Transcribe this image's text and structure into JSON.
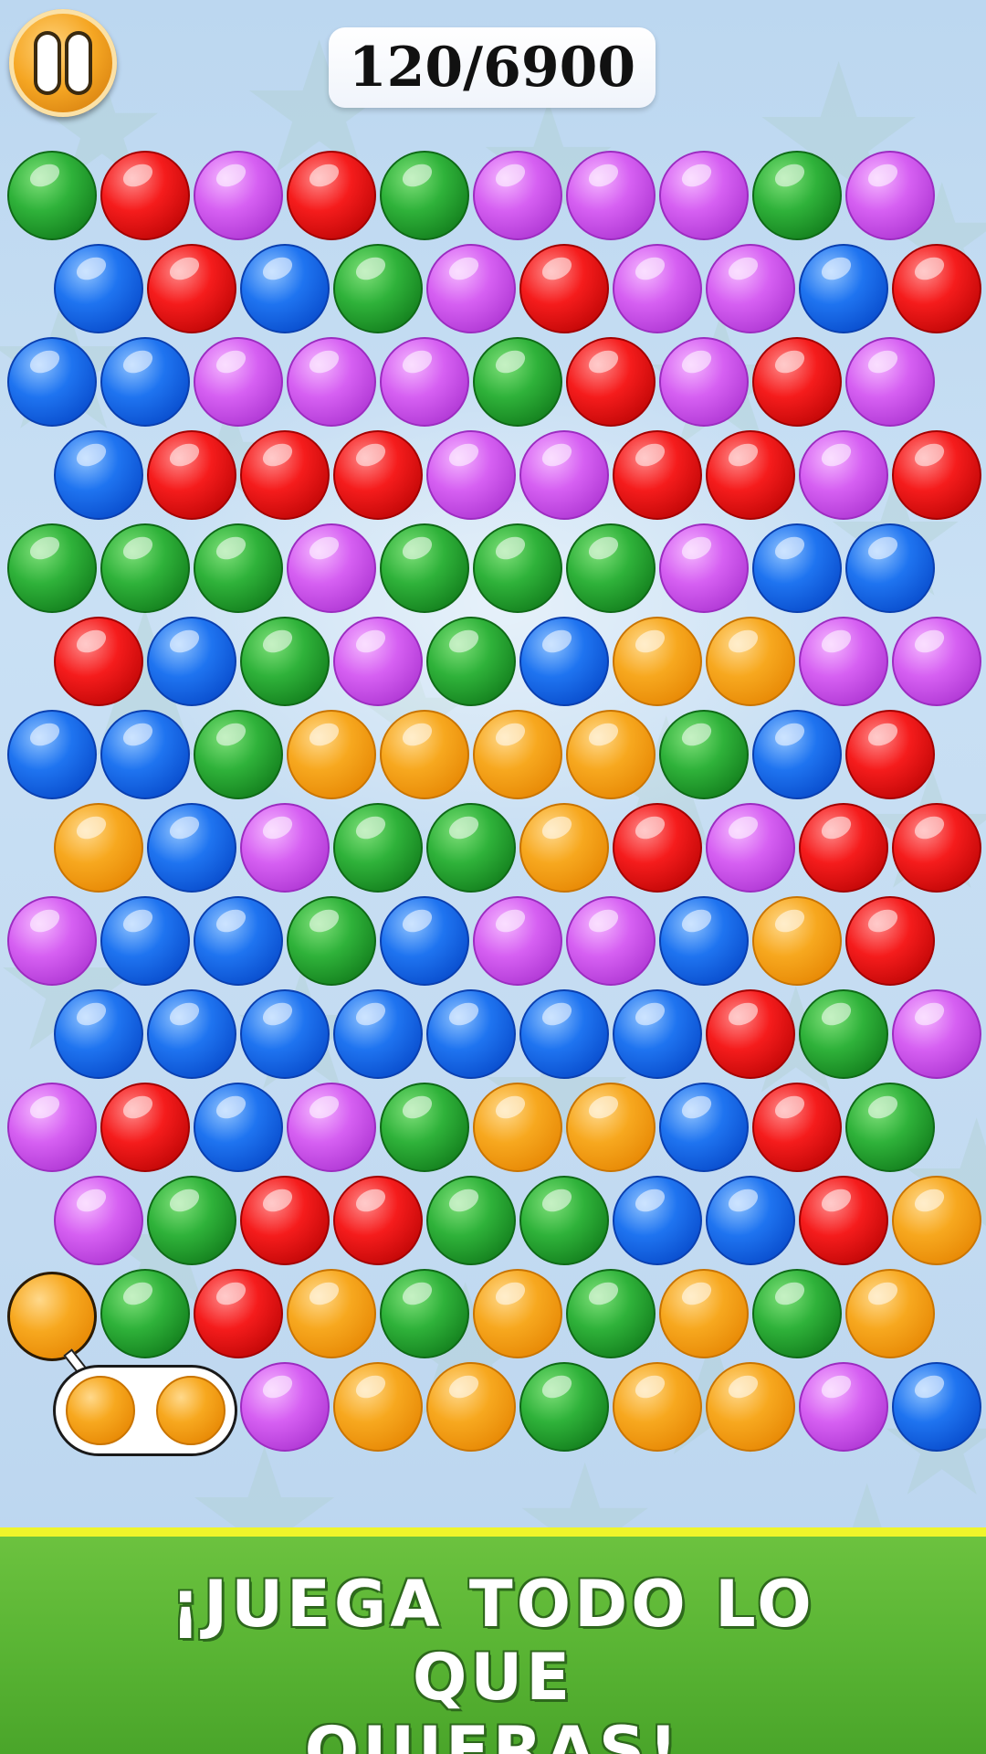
{
  "hud": {
    "score_text": "120/6900",
    "pause_icon": "pause-icon"
  },
  "banner": {
    "line1": "¡JUEGA TODO LO QUE",
    "line2": "QUIERAS!"
  },
  "colors": {
    "green": "#2fb23a",
    "red": "#f51c1c",
    "purple": "#d660f2",
    "blue": "#1f74f0",
    "orange": "#f7a81f",
    "banner_green": "#5ab534",
    "banner_stripe": "#f0f52a"
  },
  "board": {
    "rows": [
      [
        "green",
        "red",
        "purple",
        "red",
        "green",
        "purple",
        "purple",
        "purple",
        "green",
        "purple"
      ],
      [
        "blue",
        "red",
        "blue",
        "green",
        "purple",
        "red",
        "purple",
        "purple",
        "blue",
        "red"
      ],
      [
        "blue",
        "blue",
        "purple",
        "purple",
        "purple",
        "green",
        "red",
        "purple",
        "red",
        "purple"
      ],
      [
        "blue",
        "red",
        "red",
        "red",
        "purple",
        "purple",
        "red",
        "red",
        "purple",
        "red"
      ],
      [
        "green",
        "green",
        "green",
        "purple",
        "green",
        "green",
        "green",
        "purple",
        "blue",
        "blue"
      ],
      [
        "red",
        "blue",
        "green",
        "purple",
        "green",
        "blue",
        "orange",
        "orange",
        "purple",
        "purple"
      ],
      [
        "blue",
        "blue",
        "green",
        "orange",
        "orange",
        "orange",
        "orange",
        "green",
        "blue",
        "red"
      ],
      [
        "orange",
        "blue",
        "purple",
        "green",
        "green",
        "orange",
        "red",
        "purple",
        "red",
        "red"
      ],
      [
        "purple",
        "blue",
        "blue",
        "green",
        "blue",
        "purple",
        "purple",
        "blue",
        "orange",
        "red"
      ],
      [
        "blue",
        "blue",
        "blue",
        "blue",
        "blue",
        "blue",
        "blue",
        "red",
        "green",
        "purple"
      ],
      [
        "purple",
        "red",
        "blue",
        "purple",
        "green",
        "orange",
        "orange",
        "blue",
        "red",
        "green"
      ],
      [
        "purple",
        "green",
        "red",
        "red",
        "green",
        "green",
        "blue",
        "blue",
        "red",
        "orange"
      ],
      [
        null,
        "green",
        "red",
        "orange",
        "green",
        "orange",
        "green",
        "orange",
        "green",
        "orange"
      ],
      [
        null,
        null,
        "purple",
        "orange",
        "orange",
        "green",
        "orange",
        "orange",
        "purple",
        "blue"
      ]
    ]
  },
  "shooter": {
    "current_color": "orange",
    "next_colors": [
      "orange",
      "orange"
    ]
  }
}
